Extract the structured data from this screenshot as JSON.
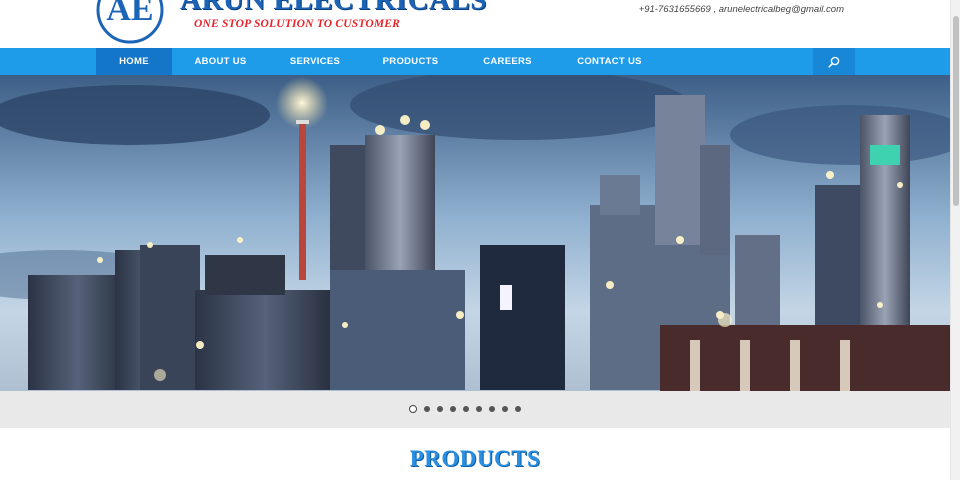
{
  "header": {
    "brand_name": "ARUN ELECTRICALS",
    "brand_initials": "AE",
    "tagline": "ONE STOP SOLUTION TO CUSTOMER",
    "contact": "+91-7631655669 , arunelectricalbeg@gmail.com"
  },
  "nav": {
    "items": [
      {
        "label": "HOME",
        "active": true
      },
      {
        "label": "ABOUT US",
        "active": false
      },
      {
        "label": "SERVICES",
        "active": false
      },
      {
        "label": "PRODUCTS",
        "active": false
      },
      {
        "label": "CAREERS",
        "active": false
      },
      {
        "label": "CONTACT US",
        "active": false
      }
    ],
    "search_icon": "search-icon"
  },
  "slider": {
    "slide_count": 9,
    "active_index": 0,
    "image": "industrial refinery at night"
  },
  "products": {
    "title": "PRODUCTS"
  },
  "colors": {
    "nav_bg": "#1e9be9",
    "nav_active": "#1476c8",
    "brand_blue": "#1b64b7",
    "tagline_red": "#e8232a",
    "section_title": "#2a8fe0"
  }
}
